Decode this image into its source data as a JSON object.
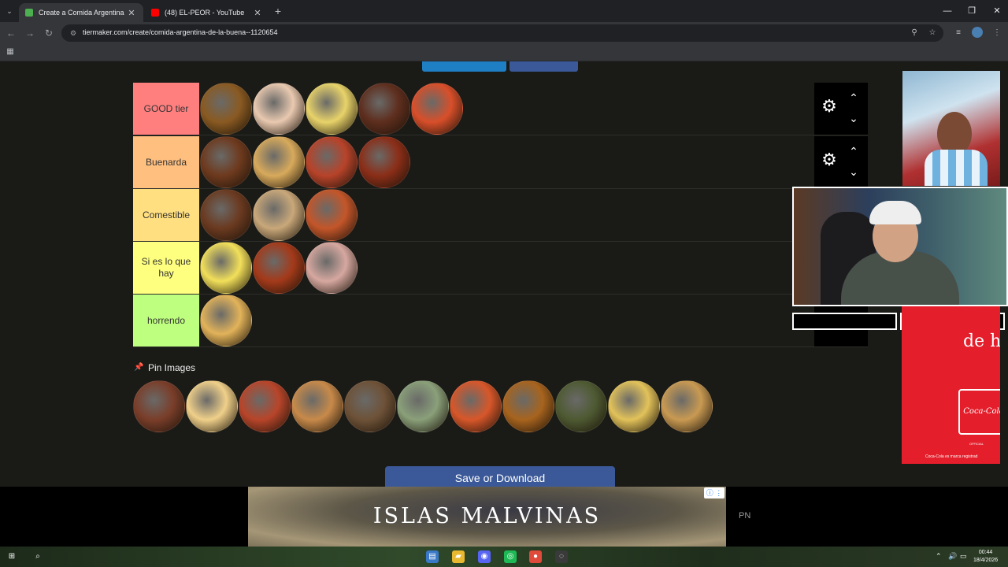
{
  "browser": {
    "tabs": [
      {
        "title": "Create a Comida Argentina de",
        "fav_color": "#4caf50",
        "active": true
      },
      {
        "title": "(48) EL-PEOR - YouTube",
        "fav_color": "#ff0000",
        "active": false
      }
    ],
    "url": "tiermaker.com/create/comida-argentina-de-la-buena--1120654",
    "icons": {
      "tab_menu": "chevron-down-icon",
      "new_tab": "plus-icon",
      "minimize": "minimize-icon",
      "restore": "restore-icon",
      "close": "close-icon",
      "back": "arrow-left-icon",
      "forward": "arrow-right-icon",
      "reload": "reload-icon",
      "site_info": "tune-icon",
      "zoom": "zoom-icon",
      "bookmark": "star-icon",
      "media": "media-control-icon",
      "menu": "kebab-menu-icon",
      "apps": "apps-grid-icon"
    }
  },
  "tiers": [
    {
      "label": "GOOD tier",
      "color": "#ff7f7f",
      "items": [
        "#8a5a22",
        "#e9c9b0",
        "#e8d36a",
        "#5e2e1e",
        "#d94f2a"
      ]
    },
    {
      "label": "Buenarda",
      "color": "#ffbf7f",
      "items": [
        "#6e3a1e",
        "#d8aa5c",
        "#b8432a",
        "#8b2e18"
      ]
    },
    {
      "label": "Comestible",
      "color": "#ffdf7f",
      "items": [
        "#6b3a20",
        "#c9a87a",
        "#c4562a"
      ]
    },
    {
      "label": "Si es lo que hay",
      "color": "#ffff7f",
      "items": [
        "#f2e05a",
        "#a43a1a",
        "#d6a8a0"
      ]
    },
    {
      "label": "horrendo",
      "color": "#bfff7f",
      "items": [
        "#e2b35a"
      ]
    }
  ],
  "pin_label": "Pin Images",
  "pool_items": [
    "#7a3e2a",
    "#f0d08a",
    "#b8452a",
    "#c88a4a",
    "#6e5238",
    "#8aa07a",
    "#d8572a",
    "#a8641e",
    "#4e5a32",
    "#e2c25a",
    "#c99a52"
  ],
  "save_label": "Save or Download",
  "ad": {
    "title": "ISLAS MALVINAS",
    "adchoice": "ⓘ ⋮"
  },
  "pn_text": "PN",
  "coke": {
    "big_text": "de h",
    "logo": "Coca-Cola",
    "official": "OFFICIAL",
    "fine_print": "Coca-Cola es marca registrad"
  },
  "taskbar": {
    "clock_time": "00:44",
    "clock_date": "18/4/2026",
    "apps": [
      {
        "name": "start-icon",
        "color": "transparent"
      },
      {
        "name": "search-icon",
        "color": "transparent"
      },
      {
        "name": "store-icon",
        "color": "#3a78c8"
      },
      {
        "name": "folder-icon",
        "color": "#e8b830"
      },
      {
        "name": "discord-icon",
        "color": "#5865f2"
      },
      {
        "name": "spotify-icon",
        "color": "#1db954"
      },
      {
        "name": "chrome-icon",
        "color": "#e04a3a"
      },
      {
        "name": "obs-icon",
        "color": "#3a3a3a"
      }
    ]
  }
}
